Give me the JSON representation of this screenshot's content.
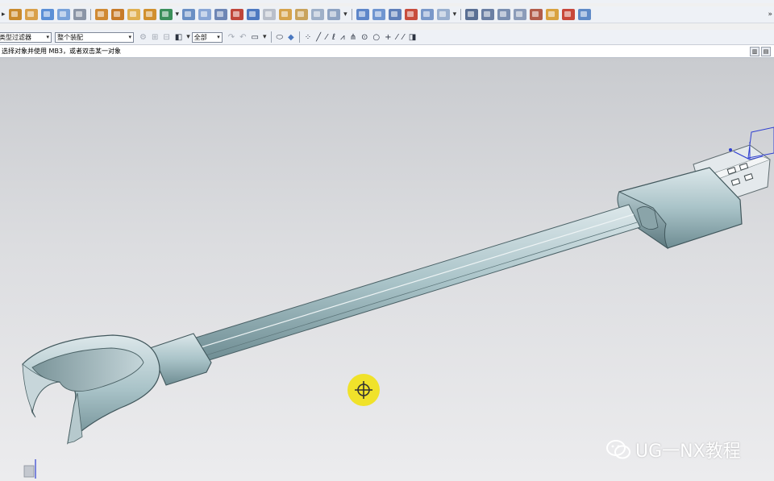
{
  "selection_bar": {
    "type_filter": "类型过滤器",
    "scope": "整个装配",
    "snap_scope": "全部"
  },
  "status": {
    "prompt": "选择对象并使用 MB3，或者双击某一对象"
  },
  "watermark": {
    "text": "UG一NX教程"
  },
  "colors": {
    "accent_blue": "#2f6fd0",
    "model_steel": "#a9c3c8",
    "cursor_yellow": "#f0e22a"
  },
  "icons": {
    "toolbar_row1": [
      "new-icon",
      "open-icon",
      "save-icon",
      "cut-icon",
      "copy-icon",
      "paste-icon",
      "undo-icon",
      "redo-icon",
      "sketch-icon",
      "extrude-icon",
      "revolve-icon",
      "hole-icon",
      "boss-icon",
      "pocket-icon",
      "pad-icon",
      "blend-icon",
      "chamfer-icon",
      "shell-icon",
      "draft-icon",
      "pattern-icon",
      "mirror-icon",
      "trim-body-icon",
      "split-body-icon",
      "unite-icon",
      "subtract-icon",
      "intersect-icon",
      "offset-face-icon",
      "thicken-icon",
      "sweep-icon",
      "tube-icon",
      "surface-icon",
      "through-curves-icon",
      "bounded-plane-icon",
      "sew-icon",
      "line-icon",
      "arc-icon",
      "spline-icon",
      "point-icon",
      "datum-plane-icon",
      "datum-csys-icon",
      "measure-icon",
      "analysis-icon",
      "more-icon"
    ],
    "toolbar_row2": [
      "box-icon",
      "cylinder-icon",
      "cone-icon",
      "sphere-icon",
      "edge-blend-icon",
      "face-blend-icon",
      "snap-point-icon",
      "end-point-icon",
      "mid-point-icon",
      "control-point-icon",
      "intersection-icon",
      "arc-center-icon",
      "quadrant-icon",
      "point-on-curve-icon",
      "point-on-face-icon",
      "view-icon"
    ]
  }
}
